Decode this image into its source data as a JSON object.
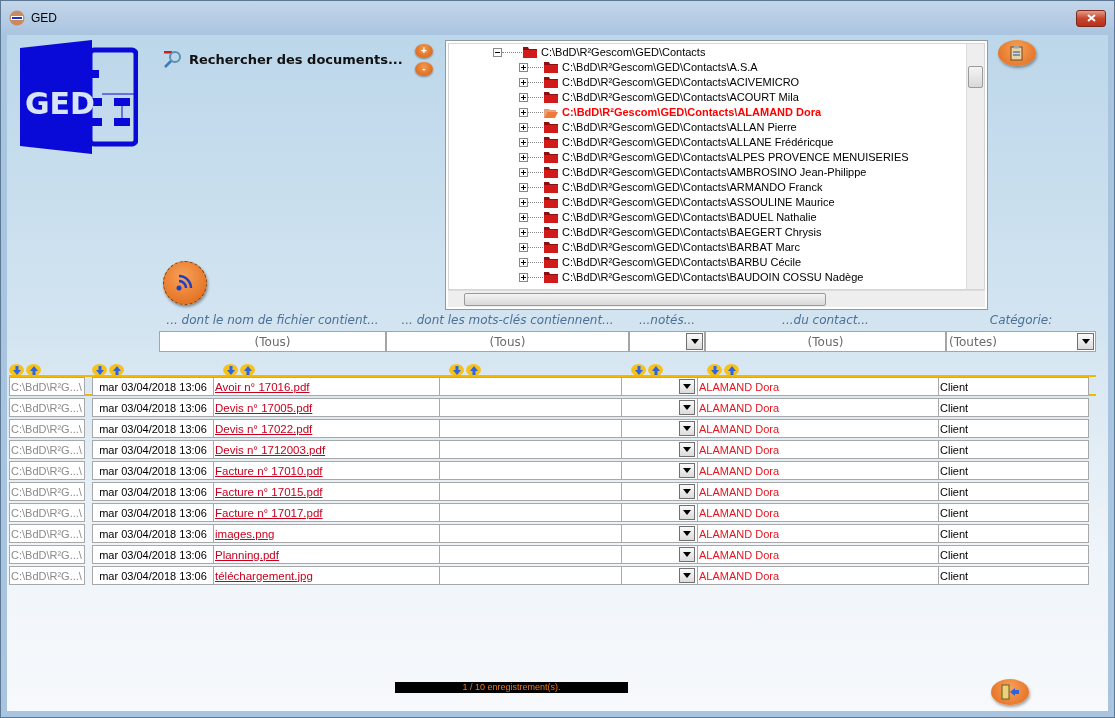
{
  "window": {
    "title": "GED"
  },
  "logo": {
    "text": "GED"
  },
  "search": {
    "title": "Rechercher des documents...",
    "buttons": [
      "+",
      "-"
    ]
  },
  "tree": {
    "items": [
      {
        "label": "C:\\BdD\\R²Gescom\\GED\\Contacts",
        "expanded": true,
        "selected": false,
        "children": [
          {
            "label": "C:\\BdD\\R²Gescom\\GED\\Contacts\\A.S.A",
            "expanded": false,
            "selected": false
          },
          {
            "label": "C:\\BdD\\R²Gescom\\GED\\Contacts\\ACIVEMICRO",
            "expanded": false,
            "selected": false
          },
          {
            "label": "C:\\BdD\\R²Gescom\\GED\\Contacts\\ACOURT Mila",
            "expanded": false,
            "selected": false
          },
          {
            "label": "C:\\BdD\\R²Gescom\\GED\\Contacts\\ALAMAND Dora",
            "expanded": false,
            "selected": true
          },
          {
            "label": "C:\\BdD\\R²Gescom\\GED\\Contacts\\ALLAN Pierre",
            "expanded": false,
            "selected": false
          },
          {
            "label": "C:\\BdD\\R²Gescom\\GED\\Contacts\\ALLANE Frédéricque",
            "expanded": false,
            "selected": false
          },
          {
            "label": "C:\\BdD\\R²Gescom\\GED\\Contacts\\ALPES PROVENCE MENUISERIES",
            "expanded": false,
            "selected": false
          },
          {
            "label": "C:\\BdD\\R²Gescom\\GED\\Contacts\\AMBROSINO Jean-Philippe",
            "expanded": false,
            "selected": false
          },
          {
            "label": "C:\\BdD\\R²Gescom\\GED\\Contacts\\ARMANDO Franck",
            "expanded": false,
            "selected": false
          },
          {
            "label": "C:\\BdD\\R²Gescom\\GED\\Contacts\\ASSOULINE Maurice",
            "expanded": false,
            "selected": false
          },
          {
            "label": "C:\\BdD\\R²Gescom\\GED\\Contacts\\BADUEL Nathalie",
            "expanded": false,
            "selected": false
          },
          {
            "label": "C:\\BdD\\R²Gescom\\GED\\Contacts\\BAEGERT Chrysis",
            "expanded": false,
            "selected": false
          },
          {
            "label": "C:\\BdD\\R²Gescom\\GED\\Contacts\\BARBAT Marc",
            "expanded": false,
            "selected": false
          },
          {
            "label": "C:\\BdD\\R²Gescom\\GED\\Contacts\\BARBU Cécile",
            "expanded": false,
            "selected": false
          },
          {
            "label": "C:\\BdD\\R²Gescom\\GED\\Contacts\\BAUDOIN COSSU Nadège",
            "expanded": false,
            "selected": false
          }
        ]
      }
    ]
  },
  "filters": [
    {
      "kind": "text",
      "label": "... dont le nom de fichier contient...",
      "value": "(Tous)"
    },
    {
      "kind": "text",
      "label": "... dont les mots-clés contiennent...",
      "value": "(Tous)"
    },
    {
      "kind": "dropdown",
      "label": "...notés..."
    },
    {
      "kind": "text",
      "label": "...du contact...",
      "value": "(Tous)"
    },
    {
      "kind": "dropdown",
      "label": "Catégorie:",
      "value": "(Toutes)"
    }
  ],
  "table": {
    "columns": [
      {
        "kind": "path",
        "sortable": true
      },
      {
        "kind": "date",
        "sortable": true
      },
      {
        "kind": "file",
        "sortable": true
      },
      {
        "kind": "keywords",
        "sortable": true
      },
      {
        "kind": "notes",
        "sortable": true
      },
      {
        "kind": "contact",
        "sortable": true
      },
      {
        "kind": "category",
        "sortable": false
      }
    ],
    "rows": [
      {
        "path": "C:\\BdD\\R²G...\\",
        "date": "mar 03/04/2018 13:06",
        "file": "Avoir n° 17016.pdf",
        "contact": "ALAMAND Dora",
        "category": "Client",
        "selected": true
      },
      {
        "path": "C:\\BdD\\R²G...\\",
        "date": "mar 03/04/2018 13:06",
        "file": "Devis n° 17005.pdf",
        "contact": "ALAMAND Dora",
        "category": "Client",
        "selected": false
      },
      {
        "path": "C:\\BdD\\R²G...\\",
        "date": "mar 03/04/2018 13:06",
        "file": "Devis n° 17022.pdf",
        "contact": "ALAMAND Dora",
        "category": "Client",
        "selected": false
      },
      {
        "path": "C:\\BdD\\R²G...\\",
        "date": "mar 03/04/2018 13:06",
        "file": "Devis n° 1712003.pdf",
        "contact": "ALAMAND Dora",
        "category": "Client",
        "selected": false
      },
      {
        "path": "C:\\BdD\\R²G...\\",
        "date": "mar 03/04/2018 13:06",
        "file": "Facture n° 17010.pdf",
        "contact": "ALAMAND Dora",
        "category": "Client",
        "selected": false
      },
      {
        "path": "C:\\BdD\\R²G...\\",
        "date": "mar 03/04/2018 13:06",
        "file": "Facture n° 17015.pdf",
        "contact": "ALAMAND Dora",
        "category": "Client",
        "selected": false
      },
      {
        "path": "C:\\BdD\\R²G...\\",
        "date": "mar 03/04/2018 13:06",
        "file": "Facture n° 17017.pdf",
        "contact": "ALAMAND Dora",
        "category": "Client",
        "selected": false
      },
      {
        "path": "C:\\BdD\\R²G...\\",
        "date": "mar 03/04/2018 13:06",
        "file": "images.png",
        "contact": "ALAMAND Dora",
        "category": "Client",
        "selected": false
      },
      {
        "path": "C:\\BdD\\R²G...\\",
        "date": "mar 03/04/2018 13:06",
        "file": "Planning.pdf",
        "contact": "ALAMAND Dora",
        "category": "Client",
        "selected": false
      },
      {
        "path": "C:\\BdD\\R²G...\\",
        "date": "mar 03/04/2018 13:06",
        "file": "téléchargement.jpg",
        "contact": "ALAMAND Dora",
        "category": "Client",
        "selected": false
      }
    ]
  },
  "status_bar": {
    "text": "1 / 10 enregistrement(s)."
  }
}
